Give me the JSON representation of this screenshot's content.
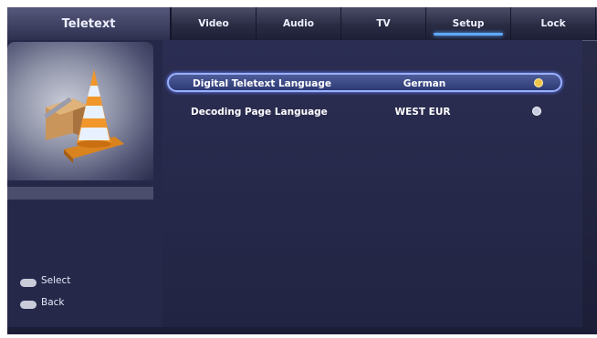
{
  "header": {
    "section_title": "Teletext",
    "tabs": [
      {
        "label": "Video"
      },
      {
        "label": "Audio"
      },
      {
        "label": "TV"
      },
      {
        "label": "Setup",
        "active": true
      },
      {
        "label": "Lock"
      }
    ]
  },
  "settings": {
    "rows": [
      {
        "label": "Digital Teletext Language",
        "value": "German",
        "selected": true
      },
      {
        "label": "Decoding Page Language",
        "value": "WEST EUR",
        "selected": false
      }
    ]
  },
  "legend": {
    "select_label": "Select",
    "back_label": "Back"
  },
  "colors": {
    "background": "#1c1e38",
    "accent": "#5fa8ff",
    "selection_border": "#9ab0ff",
    "indicator_active": "#f0c44a"
  },
  "icons": {
    "setup_illustration": "tools-cone-icon",
    "select_key": "ok-key-icon",
    "back_key": "menu-key-icon"
  }
}
